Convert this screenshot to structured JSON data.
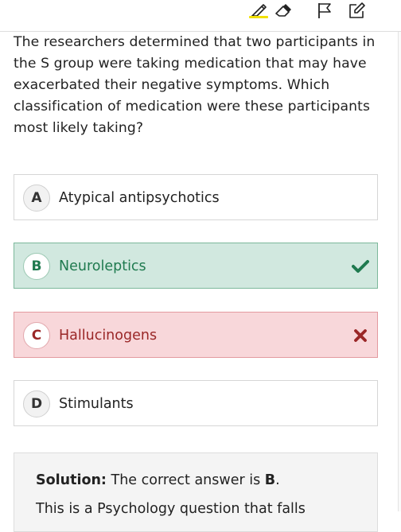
{
  "toolbar": {
    "tools": [
      {
        "name": "highlighter-icon"
      },
      {
        "name": "eraser-icon"
      },
      {
        "name": "flag-icon"
      },
      {
        "name": "edit-note-icon"
      }
    ],
    "highlight_color": "#f2e000"
  },
  "question": {
    "text": "The researchers determined that two participants in the S group were taking medication that may have exacerbated their negative symptoms. Which classification of medication were these participants most likely taking?"
  },
  "options": [
    {
      "letter": "A",
      "text": "Atypical antipsychotics",
      "state": "neutral"
    },
    {
      "letter": "B",
      "text": "Neuroleptics",
      "state": "correct",
      "icon": "checkmark-icon"
    },
    {
      "letter": "C",
      "text": "Hallucinogens",
      "state": "incorrect",
      "icon": "x-icon"
    },
    {
      "letter": "D",
      "text": "Stimulants",
      "state": "neutral"
    }
  ],
  "colors": {
    "correct_bg": "#d1e8df",
    "correct_text": "#1f7a4f",
    "wrong_bg": "#f8d7da",
    "wrong_text": "#9a2727"
  },
  "solution": {
    "label": "Solution:",
    "text_before": " The correct answer is ",
    "answer": "B",
    "text_after": ".",
    "explanation_partial": "This is a Psychology question that falls"
  }
}
